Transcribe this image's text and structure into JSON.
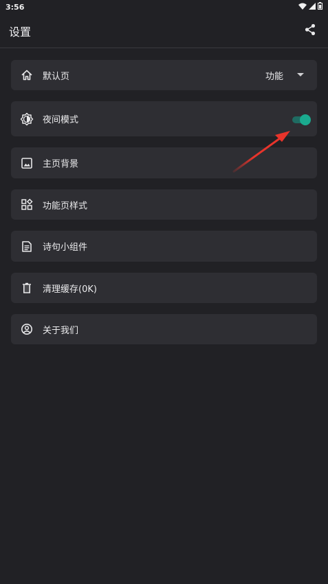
{
  "status_bar": {
    "time": "3:56",
    "icons": [
      "wifi-icon",
      "signal-icon",
      "battery-icon"
    ]
  },
  "app_bar": {
    "title": "设置",
    "action_icon": "share-icon"
  },
  "settings": [
    {
      "label": "默认页",
      "icon": "home-icon",
      "value": "功能",
      "control": "dropdown"
    },
    {
      "label": "夜间模式",
      "icon": "brightness-icon",
      "control": "toggle",
      "toggle_on": true
    },
    {
      "label": "主页背景",
      "icon": "image-icon"
    },
    {
      "label": "功能页样式",
      "icon": "widgets-icon"
    },
    {
      "label": "诗句小组件",
      "icon": "article-icon"
    },
    {
      "label": "清理缓存(0K)",
      "icon": "trash-icon"
    },
    {
      "label": "关于我们",
      "icon": "account-circle-icon"
    }
  ],
  "colors": {
    "background": "#212125",
    "card": "#2e2e33",
    "accent": "#1aaa8f",
    "annotation_arrow": "#e8342b"
  }
}
